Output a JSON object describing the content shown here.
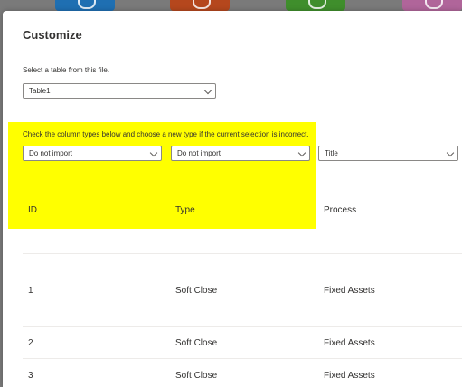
{
  "background_tiles": [
    {
      "icon": "network-icon",
      "color": "#1f6fb2"
    },
    {
      "icon": "tool-icon",
      "color": "#b5471d"
    },
    {
      "icon": "target-icon",
      "color": "#3f8e2c"
    },
    {
      "icon": "circle-icon",
      "color": "#b0659a"
    }
  ],
  "dialog": {
    "title": "Customize",
    "table_prompt": "Select a table from this file.",
    "table_select": "Table1",
    "column_types_prompt": "Check the column types below and choose a new type if the current selection is incorrect.",
    "column_type_selects": [
      "Do not import",
      "Do not import",
      "Title"
    ],
    "highlight_color": "#ffff00"
  },
  "table": {
    "headers": [
      "ID",
      "Type",
      "Process"
    ],
    "rows": [
      [
        "1",
        "Soft Close",
        "Fixed Assets"
      ],
      [
        "2",
        "Soft Close",
        "Fixed Assets"
      ],
      [
        "3",
        "Soft Close",
        "Fixed Assets"
      ]
    ]
  }
}
